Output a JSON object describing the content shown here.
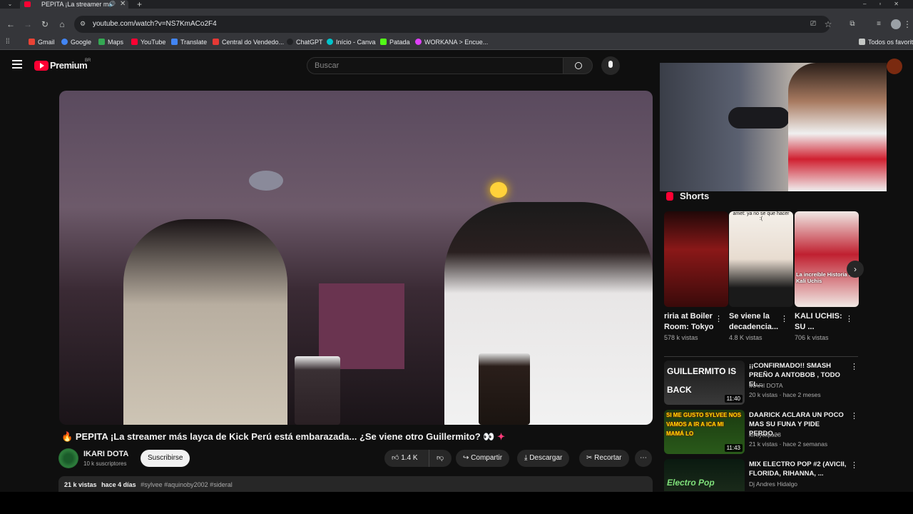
{
  "browser": {
    "tab_title": "PEPITA ¡La streamer má",
    "url": "youtube.com/watch?v=NS7KmACo2F4",
    "bookmarks": [
      "Gmail",
      "Google",
      "Maps",
      "YouTube",
      "Translate",
      "Central do Vendedo...",
      "ChatGPT",
      "Início - Canva",
      "Patada",
      "WORKANA > Encue..."
    ],
    "all_favorites": "Todos os favoritos"
  },
  "header": {
    "logo": "Premium",
    "region": "BR",
    "search_placeholder": "Buscar"
  },
  "video": {
    "title": "PEPITA ¡La streamer más layca de Kick Perú está embarazada... ¿Se viene otro Guillermito?",
    "channel": "IKARI DOTA",
    "subscribers": "10 k suscriptores",
    "subscribe_label": "Suscribirse",
    "likes": "1.4 K",
    "share_label": "Compartir",
    "download_label": "Descargar",
    "clip_label": "Recortar",
    "views": "21 k vistas",
    "age": "hace 4 días",
    "hashtags": "#sylvee #aquinoby2002 #sideral"
  },
  "shorts": {
    "heading": "Shorts",
    "items": [
      {
        "title": "riria at Boiler Room: Tokyo",
        "views": "578 k vistas"
      },
      {
        "title": "Se viene la decadencia...",
        "views": "4.8 K vistas",
        "overlay": "amet: ya no se que hacer :("
      },
      {
        "title": "KALI UCHIS: SU ...",
        "views": "706 k vistas",
        "overlay": "La increíble Historia de Kali Uchis"
      }
    ]
  },
  "recommended": [
    {
      "title": "¡¡CONFIRMADO!! SMASH PREÑO A ANTOBOB , TODO EL...",
      "channel": "IKARI DOTA",
      "meta": "20 k vistas · hace 2 meses",
      "duration": "11:40",
      "thumb_text": "GUILLERMITO IS BACK"
    },
    {
      "title": "DAARICK ACLARA UN POCO MAS SU FUNA Y PIDE PERDO...",
      "channel": "leroyclips28",
      "meta": "21 k vistas · hace 2 semanas",
      "duration": "11:43",
      "thumb_text": "SI ME GUSTO SYLVEE NOS VAMOS A IR A ICA MI MAMÁ LO"
    },
    {
      "title": "MIX ELECTRO POP #2 (AVICII, FLORIDA, RIHANNA, ...",
      "channel": "Dj Andres Hidalgo",
      "meta": "",
      "duration": "",
      "thumb_text": "Electro Pop"
    }
  ],
  "colors": {
    "accent_red": "#ff0033",
    "bg": "#0f0f0f"
  }
}
